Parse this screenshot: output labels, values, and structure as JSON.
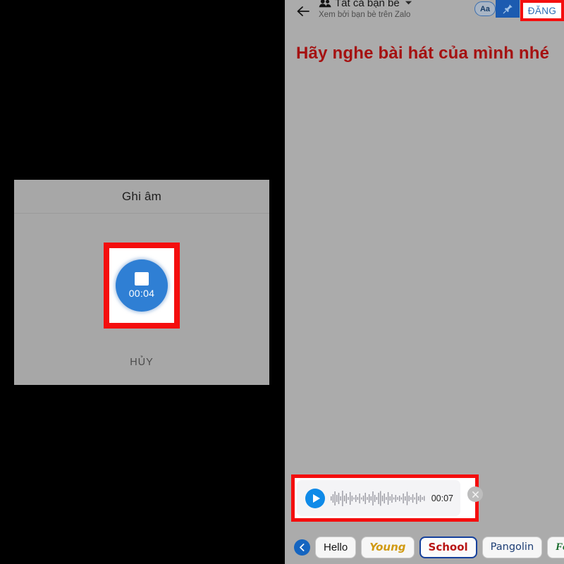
{
  "recorder_dialog": {
    "title": "Ghi âm",
    "elapsed_time": "00:04",
    "stop_icon": "stop-square-icon",
    "cancel_label": "HỦY",
    "highlight_color": "#f40e0e",
    "accent_color": "#2f7fd4"
  },
  "composer": {
    "header": {
      "back_icon": "back-arrow-icon",
      "group_icon": "group-people-icon",
      "audience": "Tất cả bạn bè",
      "dropdown_icon": "chevron-down-icon",
      "subtitle": "Xem bởi bạn bè trên Zalo",
      "font_toggle_label": "Aa",
      "pin_icon": "pin-icon",
      "post_label": "ĐĂNG",
      "post_color": "#2b6db5"
    },
    "post_text": "Hãy nghe bài hát của mình nhé",
    "post_text_color": "#a51111",
    "audio": {
      "play_icon": "play-icon",
      "waveform_icon": "audio-waveform",
      "duration": "00:07",
      "remove_icon": "close-x-icon",
      "highlight_color": "#f40e0e"
    },
    "font_bar": {
      "collapse_icon": "chevron-left-icon",
      "chips": [
        {
          "label": "Hello",
          "style": "chip-hello",
          "selected": false
        },
        {
          "label": "Young",
          "style": "chip-young",
          "selected": false
        },
        {
          "label": "School",
          "style": "chip-school",
          "selected": true
        },
        {
          "label": "Pangolin",
          "style": "chip-pangolin",
          "selected": false
        },
        {
          "label": "Fountain",
          "style": "chip-fountain",
          "selected": false
        }
      ]
    }
  }
}
